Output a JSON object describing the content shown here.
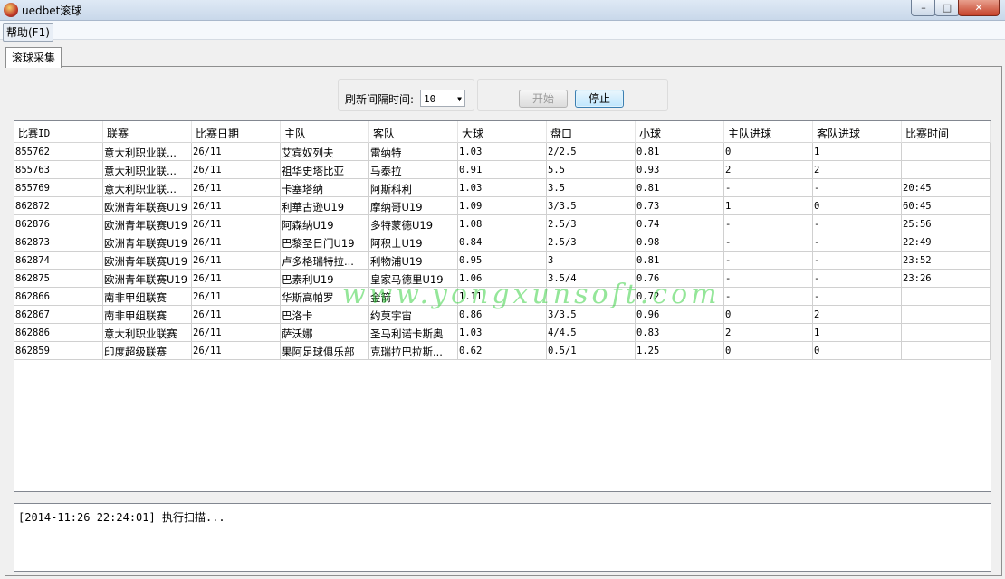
{
  "window": {
    "title": "uedbet滚球",
    "minimize": "–",
    "maximize": "□",
    "close": "✕"
  },
  "menu": {
    "help": "帮助(F1)"
  },
  "tab": {
    "label": "滚球采集"
  },
  "controls": {
    "refresh_label": "刷新间隔时间:",
    "refresh_value": "10",
    "start_label": "开始",
    "stop_label": "停止"
  },
  "table": {
    "columns": [
      "比赛ID",
      "联赛",
      "比赛日期",
      "主队",
      "客队",
      "大球",
      "盘口",
      "小球",
      "主队进球",
      "客队进球",
      "比赛时间"
    ],
    "rows": [
      [
        "855762",
        "意大利职业联...",
        "26/11",
        "艾宾奴列夫",
        "雷纳特",
        "1.03",
        "2/2.5",
        "0.81",
        "0",
        "1",
        ""
      ],
      [
        "855763",
        "意大利职业联...",
        "26/11",
        "祖华史塔比亚",
        "马泰拉",
        "0.91",
        "5.5",
        "0.93",
        "2",
        "2",
        ""
      ],
      [
        "855769",
        "意大利职业联...",
        "26/11",
        "卡塞塔纳",
        "阿斯科利",
        "1.03",
        "3.5",
        "0.81",
        "-",
        "-",
        "20:45"
      ],
      [
        "862872",
        "欧洲青年联赛U19",
        "26/11",
        "利華古逊U19",
        "摩纳哥U19",
        "1.09",
        "3/3.5",
        "0.73",
        "1",
        "0",
        "60:45"
      ],
      [
        "862876",
        "欧洲青年联赛U19",
        "26/11",
        "阿森纳U19",
        "多特蒙德U19",
        "1.08",
        "2.5/3",
        "0.74",
        "-",
        "-",
        "25:56"
      ],
      [
        "862873",
        "欧洲青年联赛U19",
        "26/11",
        "巴黎圣日门U19",
        "阿积士U19",
        "0.84",
        "2.5/3",
        "0.98",
        "-",
        "-",
        "22:49"
      ],
      [
        "862874",
        "欧洲青年联赛U19",
        "26/11",
        "卢多格瑞特拉...",
        "利物浦U19",
        "0.95",
        "3",
        "0.81",
        "-",
        "-",
        "23:52"
      ],
      [
        "862875",
        "欧洲青年联赛U19",
        "26/11",
        "巴素利U19",
        "皇家马德里U19",
        "1.06",
        "3.5/4",
        "0.76",
        "-",
        "-",
        "23:26"
      ],
      [
        "862866",
        "南非甲组联赛",
        "26/11",
        "华斯高帕罗",
        "金箭",
        "1.11",
        "",
        "0.72",
        "-",
        "-",
        ""
      ],
      [
        "862867",
        "南非甲组联赛",
        "26/11",
        "巴洛卡",
        "约莫宇宙",
        "0.86",
        "3/3.5",
        "0.96",
        "0",
        "2",
        ""
      ],
      [
        "862886",
        "意大利职业联赛",
        "26/11",
        "萨沃娜",
        "圣马利诺卡斯奥",
        "1.03",
        "4/4.5",
        "0.83",
        "2",
        "1",
        ""
      ],
      [
        "862859",
        "印度超级联赛",
        "26/11",
        "果阿足球俱乐部",
        "克瑞拉巴拉斯...",
        "0.62",
        "0.5/1",
        "1.25",
        "0",
        "0",
        ""
      ]
    ]
  },
  "watermark": "www.yongxunsoft.com",
  "log": {
    "text": "[2014-11:26 22:24:01] 执行扫描..."
  }
}
